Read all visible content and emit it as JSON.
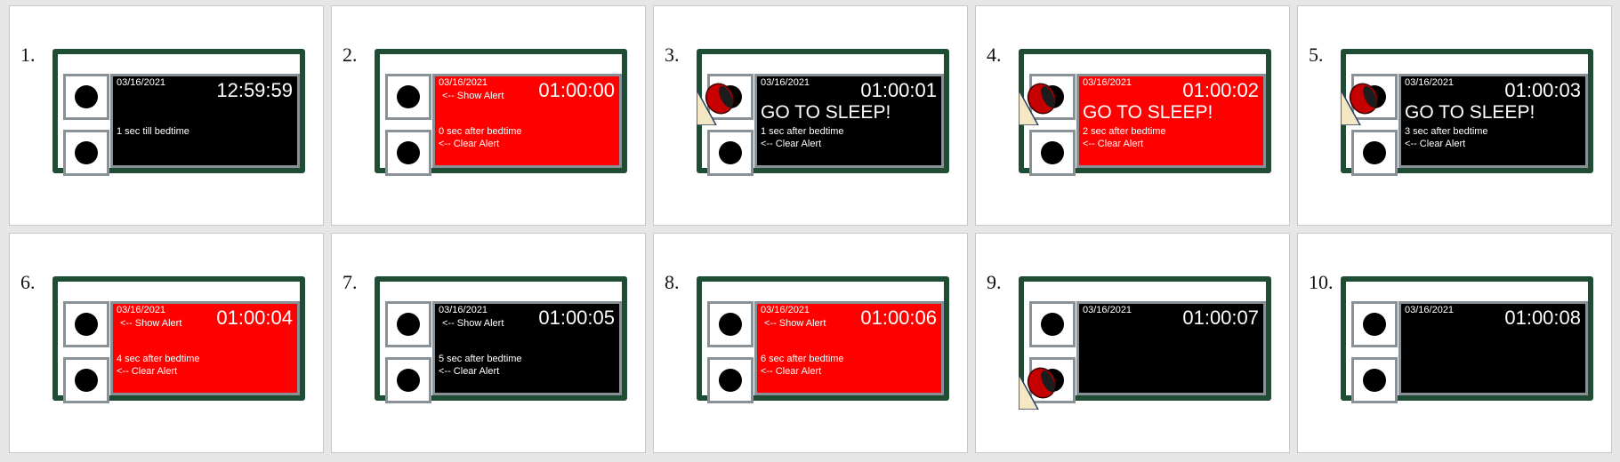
{
  "colors": {
    "frame": "#1f4d33",
    "bezel": "#8a9196",
    "alert_red": "#ff0000",
    "screen_black": "#000000"
  },
  "panels": [
    {
      "num": "1.",
      "date": "03/16/2021",
      "time": "12:59:59",
      "bg": "black",
      "show_alert": "",
      "go_to_sleep": "",
      "message": "1 sec till bedtime",
      "clear_alert": "",
      "gadget": "none"
    },
    {
      "num": "2.",
      "date": "03/16/2021",
      "time": "01:00:00",
      "bg": "red",
      "show_alert": "<-- Show Alert",
      "go_to_sleep": "",
      "message": "0 sec after bedtime",
      "clear_alert": "<-- Clear Alert",
      "gadget": "none"
    },
    {
      "num": "3.",
      "date": "03/16/2021",
      "time": "01:00:01",
      "bg": "black",
      "show_alert": "",
      "go_to_sleep": "GO TO SLEEP!",
      "message": "1 sec after bedtime",
      "clear_alert": "<-- Clear Alert",
      "gadget": "top"
    },
    {
      "num": "4.",
      "date": "03/16/2021",
      "time": "01:00:02",
      "bg": "red",
      "show_alert": "",
      "go_to_sleep": "GO TO SLEEP!",
      "message": "2 sec after bedtime",
      "clear_alert": "<-- Clear Alert",
      "gadget": "top"
    },
    {
      "num": "5.",
      "date": "03/16/2021",
      "time": "01:00:03",
      "bg": "black",
      "show_alert": "",
      "go_to_sleep": "GO TO SLEEP!",
      "message": "3 sec after bedtime",
      "clear_alert": "<-- Clear Alert",
      "gadget": "top"
    },
    {
      "num": "6.",
      "date": "03/16/2021",
      "time": "01:00:04",
      "bg": "red",
      "show_alert": "<-- Show Alert",
      "go_to_sleep": "",
      "message": "4 sec after bedtime",
      "clear_alert": "<-- Clear Alert",
      "gadget": "none"
    },
    {
      "num": "7.",
      "date": "03/16/2021",
      "time": "01:00:05",
      "bg": "black",
      "show_alert": "<-- Show Alert",
      "go_to_sleep": "",
      "message": "5 sec after bedtime",
      "clear_alert": "<-- Clear Alert",
      "gadget": "none"
    },
    {
      "num": "8.",
      "date": "03/16/2021",
      "time": "01:00:06",
      "bg": "red",
      "show_alert": "<-- Show Alert",
      "go_to_sleep": "",
      "message": "6 sec after bedtime",
      "clear_alert": "<-- Clear Alert",
      "gadget": "none"
    },
    {
      "num": "9.",
      "date": "03/16/2021",
      "time": "01:00:07",
      "bg": "black",
      "show_alert": "",
      "go_to_sleep": "",
      "message": "",
      "clear_alert": "",
      "gadget": "bottom"
    },
    {
      "num": "10.",
      "date": "03/16/2021",
      "time": "01:00:08",
      "bg": "black",
      "show_alert": "",
      "go_to_sleep": "",
      "message": "",
      "clear_alert": "",
      "gadget": "none"
    }
  ]
}
